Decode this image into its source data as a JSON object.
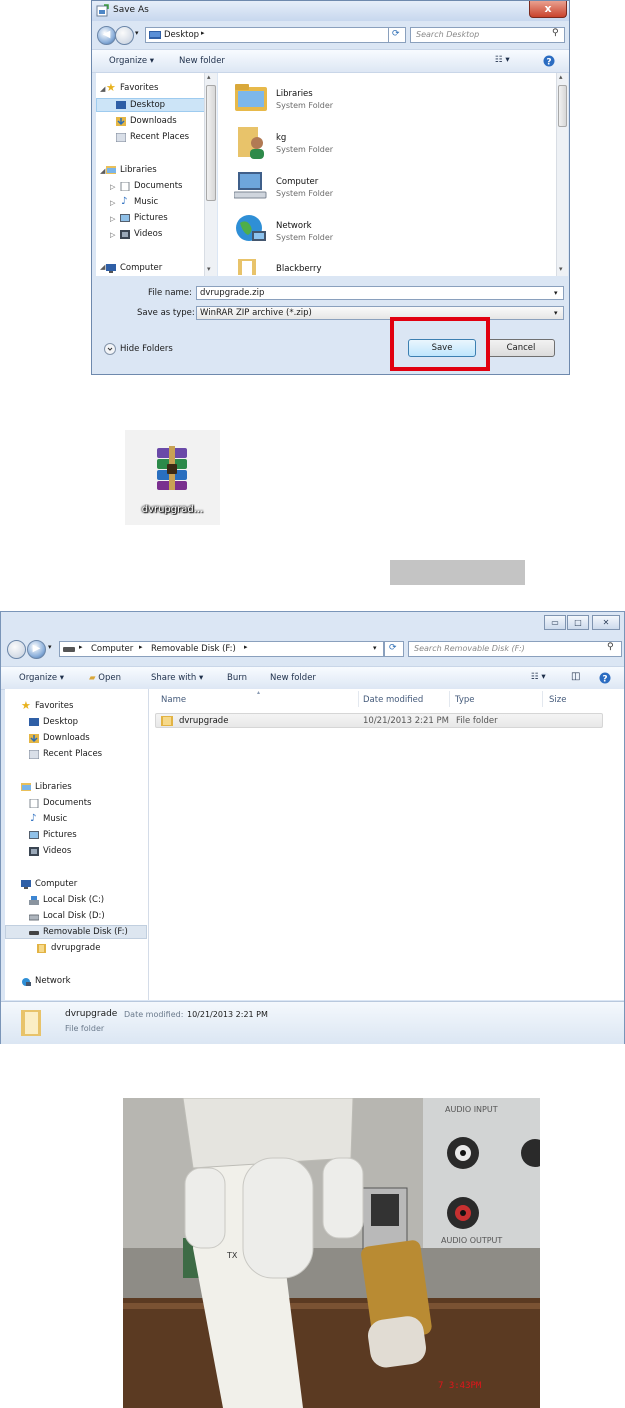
{
  "save_dialog": {
    "title": "Save As",
    "close_glyph": "x",
    "address_crumbs": [
      "Desktop"
    ],
    "search_placeholder": "Search Desktop",
    "toolbar": {
      "organize": "Organize",
      "new_folder": "New folder"
    },
    "nav": {
      "favorites": "Favorites",
      "favorites_items": [
        "Desktop",
        "Downloads",
        "Recent Places"
      ],
      "libraries": "Libraries",
      "libraries_items": [
        "Documents",
        "Music",
        "Pictures",
        "Videos"
      ],
      "computer": "Computer"
    },
    "items": [
      {
        "name": "Libraries",
        "type": "System Folder"
      },
      {
        "name": "kg",
        "type": "System Folder"
      },
      {
        "name": "Computer",
        "type": "System Folder"
      },
      {
        "name": "Network",
        "type": "System Folder"
      },
      {
        "name": "Blackberry",
        "type": ""
      }
    ],
    "file_name_label": "File name:",
    "file_name_value": "dvrupgrade.zip",
    "save_type_label": "Save as type:",
    "save_type_value": "WinRAR ZIP archive (*.zip)",
    "hide_folders": "Hide Folders",
    "save_button": "Save",
    "cancel_button": "Cancel",
    "highlight_color": "#e10010"
  },
  "zip_icon": {
    "label": "dvrupgrad..."
  },
  "explorer": {
    "address_crumbs": [
      "Computer",
      "Removable Disk (F:)"
    ],
    "search_placeholder": "Search Removable Disk (F:)",
    "toolbar": {
      "organize": "Organize",
      "open": "Open",
      "share_with": "Share with",
      "burn": "Burn",
      "new_folder": "New folder"
    },
    "columns": {
      "name": "Name",
      "date_modified": "Date modified",
      "type": "Type",
      "size": "Size"
    },
    "rows": [
      {
        "name": "dvrupgrade",
        "date": "10/21/2013 2:21 PM",
        "type": "File folder",
        "size": ""
      }
    ],
    "nav": {
      "favorites": "Favorites",
      "favorites_items": [
        "Desktop",
        "Downloads",
        "Recent Places"
      ],
      "libraries": "Libraries",
      "libraries_items": [
        "Documents",
        "Music",
        "Pictures",
        "Videos"
      ],
      "computer": "Computer",
      "computer_items": [
        "Local Disk (C:)",
        "Local Disk (D:)",
        "Removable Disk (F:)"
      ],
      "sub_item": "dvrupgrade",
      "network": "Network"
    },
    "status": {
      "name": "dvrupgrade",
      "date_label": "Date modified:",
      "date_value": "10/21/2013 2:21 PM",
      "type": "File folder"
    }
  },
  "photo": {
    "port_label_1": "AUDIO INPUT",
    "port_label_2": "AUDIO OUTPUT",
    "tx_label": "TX",
    "timestamp": "7  3:43PM"
  }
}
